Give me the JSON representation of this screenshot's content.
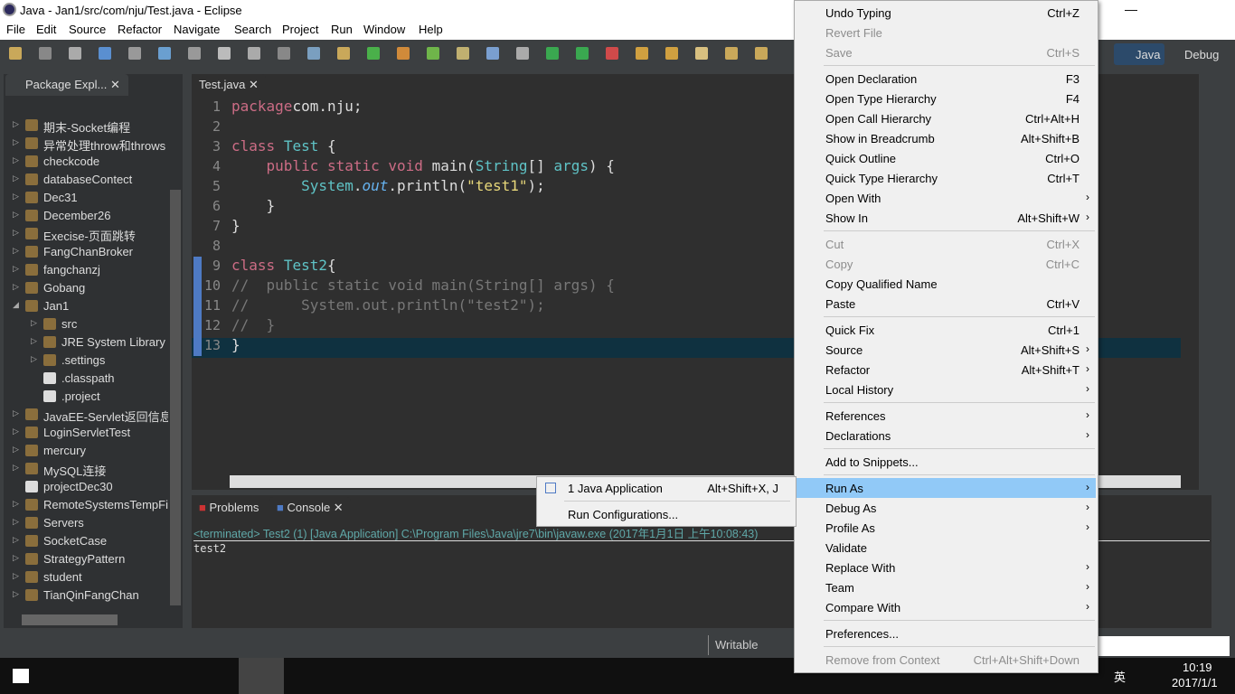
{
  "window": {
    "title": "Java - Jan1/src/com/nju/Test.java - Eclipse",
    "min": "—",
    "max": "❐",
    "close": "✕"
  },
  "menubar": [
    "File",
    "Edit",
    "Source",
    "Refactor",
    "Navigate",
    "Search",
    "Project",
    "Run",
    "Window",
    "Help"
  ],
  "perspectives": {
    "java": "Java",
    "debug": "Debug"
  },
  "package_explorer": {
    "tab": "Package Expl...",
    "items": [
      {
        "label": "期末-Socket编程",
        "level": 0,
        "exp": false
      },
      {
        "label": "异常处理throw和throws",
        "level": 0,
        "exp": false
      },
      {
        "label": "checkcode",
        "level": 0,
        "exp": false
      },
      {
        "label": "databaseContect",
        "level": 0,
        "exp": false
      },
      {
        "label": "Dec31",
        "level": 0,
        "exp": false
      },
      {
        "label": "December26",
        "level": 0,
        "exp": false
      },
      {
        "label": "Execise-页面跳转",
        "level": 0,
        "exp": false
      },
      {
        "label": "FangChanBroker",
        "level": 0,
        "exp": false
      },
      {
        "label": "fangchanzj",
        "level": 0,
        "exp": false
      },
      {
        "label": "Gobang",
        "level": 0,
        "exp": false
      },
      {
        "label": "Jan1",
        "level": 0,
        "exp": true
      },
      {
        "label": "src",
        "level": 1,
        "exp": false
      },
      {
        "label": "JRE System Library [",
        "level": 1,
        "exp": false
      },
      {
        "label": ".settings",
        "level": 1,
        "exp": false
      },
      {
        "label": ".classpath",
        "level": 1,
        "file": true
      },
      {
        "label": ".project",
        "level": 1,
        "file": true
      },
      {
        "label": "JavaEE-Servlet返回信息",
        "level": 0,
        "exp": false
      },
      {
        "label": "LoginServletTest",
        "level": 0,
        "exp": false
      },
      {
        "label": "mercury",
        "level": 0,
        "exp": false
      },
      {
        "label": "MySQL连接",
        "level": 0,
        "exp": false
      },
      {
        "label": "projectDec30",
        "level": 0,
        "file": true
      },
      {
        "label": "RemoteSystemsTempFil",
        "level": 0,
        "exp": false
      },
      {
        "label": "Servers",
        "level": 0,
        "exp": false
      },
      {
        "label": "SocketCase",
        "level": 0,
        "exp": false
      },
      {
        "label": "StrategyPattern",
        "level": 0,
        "exp": false
      },
      {
        "label": "student",
        "level": 0,
        "exp": false
      },
      {
        "label": "TianQinFangChan",
        "level": 0,
        "exp": false
      }
    ]
  },
  "editor": {
    "tab": "Test.java",
    "lines": [
      [
        [
          "kw",
          "package"
        ],
        [
          "",
          "com.nju;"
        ]
      ],
      [],
      [
        [
          "kw",
          "class"
        ],
        [
          "",
          " "
        ],
        [
          "ty",
          "Test"
        ],
        [
          "",
          " {"
        ]
      ],
      [
        [
          "",
          "    "
        ],
        [
          "kw",
          "public static void"
        ],
        [
          "",
          " "
        ],
        [
          "",
          "main("
        ],
        [
          "ty",
          "String"
        ],
        [
          "",
          "[] "
        ],
        [
          "ty",
          "args"
        ],
        [
          "",
          ") {"
        ]
      ],
      [
        [
          "",
          "        "
        ],
        [
          "ty",
          "System"
        ],
        [
          "",
          "."
        ],
        [
          "fl",
          "out"
        ],
        [
          "",
          ".println("
        ],
        [
          "st",
          "\"test1\""
        ],
        [
          "",
          ");"
        ]
      ],
      [
        [
          "",
          "    }"
        ]
      ],
      [
        [
          "",
          "}"
        ]
      ],
      [],
      [
        [
          "kw",
          "class"
        ],
        [
          "",
          " "
        ],
        [
          "ty",
          "Test2"
        ],
        [
          "",
          "{"
        ]
      ],
      [
        [
          "cm",
          "//  public static void main(String[] args) {"
        ]
      ],
      [
        [
          "cm",
          "//      System.out.println(\"test2\");"
        ]
      ],
      [
        [
          "cm",
          "//  }"
        ]
      ],
      [
        [
          "",
          "}"
        ]
      ]
    ]
  },
  "console": {
    "tabs": [
      "Problems",
      "Console"
    ],
    "header": "<terminated> Test2 (1) [Java Application] C:\\Program Files\\Java\\jre7\\bin\\javaw.exe (2017年1月1日 上午10:08:43)",
    "output": "test2"
  },
  "status": {
    "writable": "Writable"
  },
  "context_menu": [
    {
      "label": "Undo Typing",
      "sc": "Ctrl+Z"
    },
    {
      "label": "Revert File",
      "dis": true
    },
    {
      "label": "Save",
      "sc": "Ctrl+S",
      "dis": true
    },
    {
      "sep": true
    },
    {
      "label": "Open Declaration",
      "sc": "F3"
    },
    {
      "label": "Open Type Hierarchy",
      "sc": "F4"
    },
    {
      "label": "Open Call Hierarchy",
      "sc": "Ctrl+Alt+H"
    },
    {
      "label": "Show in Breadcrumb",
      "sc": "Alt+Shift+B"
    },
    {
      "label": "Quick Outline",
      "sc": "Ctrl+O"
    },
    {
      "label": "Quick Type Hierarchy",
      "sc": "Ctrl+T"
    },
    {
      "label": "Open With",
      "sub": true
    },
    {
      "label": "Show In",
      "sc": "Alt+Shift+W",
      "sub": true
    },
    {
      "sep": true
    },
    {
      "label": "Cut",
      "sc": "Ctrl+X",
      "dis": true
    },
    {
      "label": "Copy",
      "sc": "Ctrl+C",
      "dis": true
    },
    {
      "label": "Copy Qualified Name"
    },
    {
      "label": "Paste",
      "sc": "Ctrl+V"
    },
    {
      "sep": true
    },
    {
      "label": "Quick Fix",
      "sc": "Ctrl+1"
    },
    {
      "label": "Source",
      "sc": "Alt+Shift+S",
      "sub": true
    },
    {
      "label": "Refactor",
      "sc": "Alt+Shift+T",
      "sub": true
    },
    {
      "label": "Local History",
      "sub": true
    },
    {
      "sep": true
    },
    {
      "label": "References",
      "sub": true
    },
    {
      "label": "Declarations",
      "sub": true
    },
    {
      "sep": true
    },
    {
      "label": "Add to Snippets..."
    },
    {
      "sep": true
    },
    {
      "label": "Run As",
      "sub": true,
      "hl": true
    },
    {
      "label": "Debug As",
      "sub": true
    },
    {
      "label": "Profile As",
      "sub": true
    },
    {
      "label": "Validate"
    },
    {
      "label": "Replace With",
      "sub": true
    },
    {
      "label": "Team",
      "sub": true
    },
    {
      "label": "Compare With",
      "sub": true
    },
    {
      "sep": true
    },
    {
      "label": "Preferences..."
    },
    {
      "sep": true
    },
    {
      "label": "Remove from Context",
      "sc": "Ctrl+Alt+Shift+Down",
      "dis": true
    }
  ],
  "run_as_submenu": [
    {
      "label": "1 Java Application",
      "sc": "Alt+Shift+X, J"
    },
    {
      "label": "Run Configurations..."
    }
  ],
  "taskbar": {
    "time": "10:19",
    "date": "2017/1/1",
    "ime": "英"
  },
  "colors": {
    "highlight": "#91c9f7",
    "keyword": "#cc6c85",
    "type": "#5fc3c6",
    "string": "#e8d87a",
    "console_header": "#5fa8a8"
  }
}
